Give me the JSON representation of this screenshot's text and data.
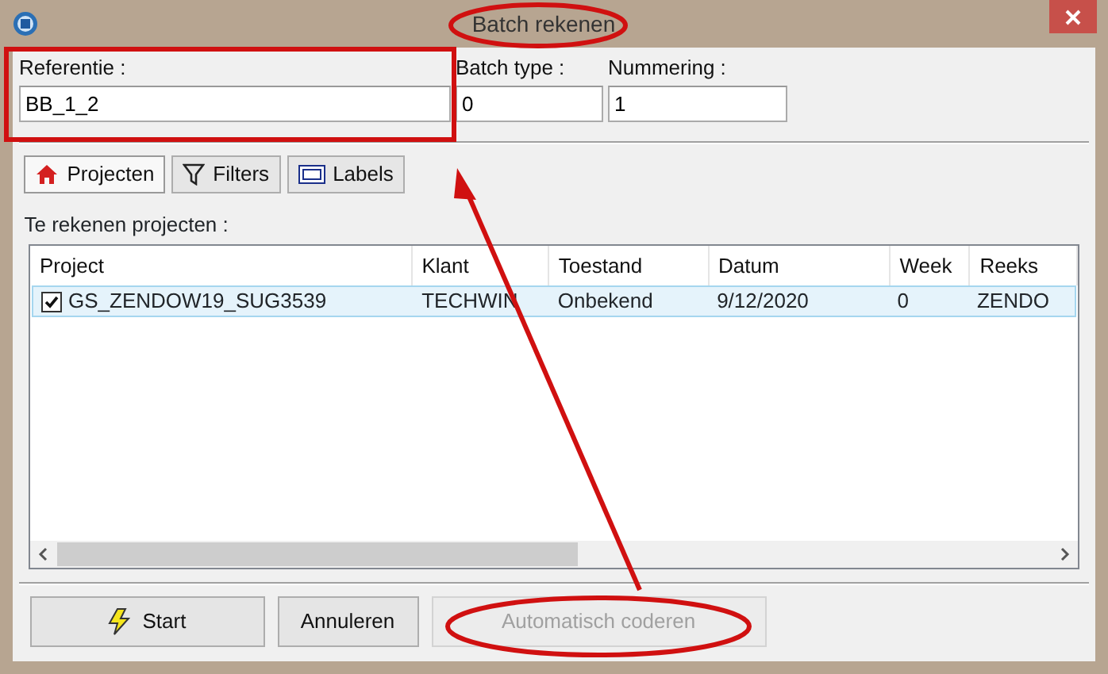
{
  "window": {
    "title": "Batch rekenen"
  },
  "fields": [
    {
      "label": "Referentie :",
      "value": "BB_1_2"
    },
    {
      "label": "Batch type :",
      "value": "0"
    },
    {
      "label": "Nummering :",
      "value": "1"
    }
  ],
  "tabs": [
    {
      "label": "Projecten",
      "kind": "home",
      "selected": true
    },
    {
      "label": "Filters",
      "kind": "filter",
      "selected": false
    },
    {
      "label": "Labels",
      "kind": "label",
      "selected": false
    }
  ],
  "list_title": "Te rekenen projecten :",
  "table": {
    "columns": [
      "Project",
      "Klant",
      "Toestand",
      "Datum",
      "Week",
      "Reeks"
    ],
    "rows": [
      {
        "checked": true,
        "selected": true,
        "cells": [
          "GS_ZENDOW19_SUG3539",
          "TECHWIN",
          "Onbekend",
          "9/12/2020",
          "0",
          "ZENDO"
        ]
      }
    ]
  },
  "buttons": [
    {
      "label": "Start",
      "kind": "bolt",
      "disabled": false
    },
    {
      "label": "Annuleren",
      "disabled": false
    },
    {
      "label": "Automatisch coderen",
      "disabled": true
    }
  ]
}
